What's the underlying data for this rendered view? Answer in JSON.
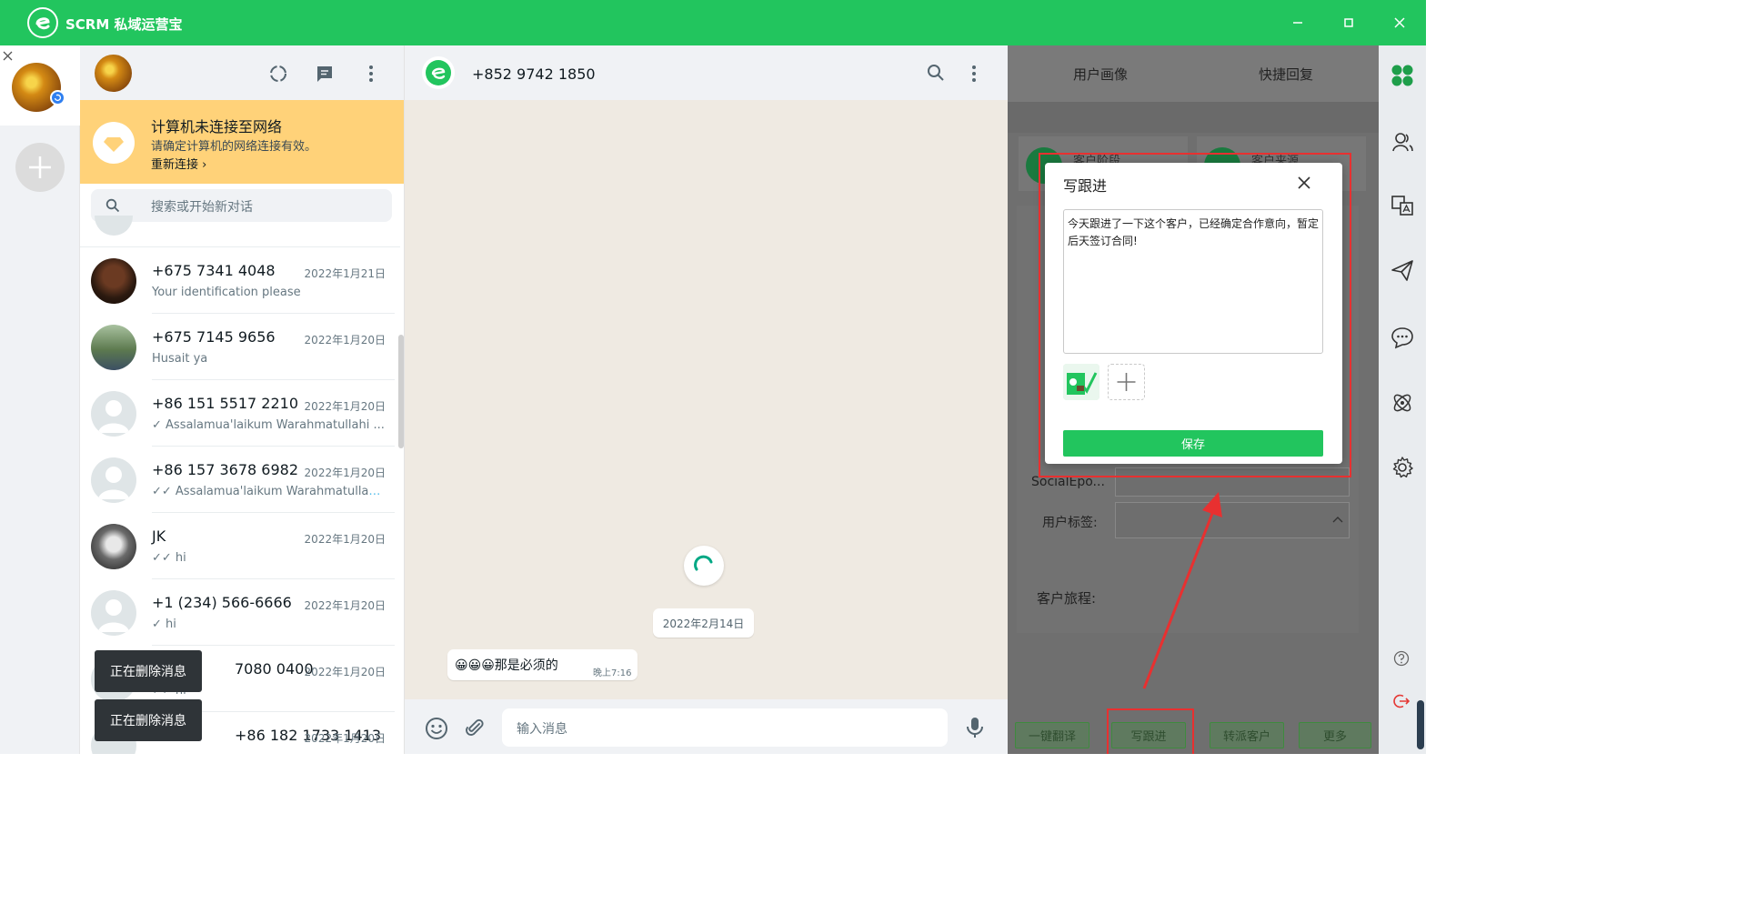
{
  "app": {
    "title": "SCRM 私域运营宝"
  },
  "chatlist": {
    "banner": {
      "title": "计算机未连接至网络",
      "subtitle": "请确定计算机的网络连接有效。",
      "link": "重新连接 ›"
    },
    "search_placeholder": "搜索或开始新对话",
    "chats": [
      {
        "name": "+675 7341 4048",
        "date": "2022年1月21日",
        "msg": "Your identification please"
      },
      {
        "name": "+675 7145 9656",
        "date": "2022年1月20日",
        "msg": "Husait ya"
      },
      {
        "name": "+86 151 5517 2210",
        "date": "2022年1月20日",
        "msg": "✓ Assalamua'laikum Warahmatullahi ..."
      },
      {
        "name": "+86 157 3678 6982",
        "date": "2022年1月20日",
        "msg": "✓✓ Assalamua'laikum Warahmatullahi ..."
      },
      {
        "name": "JK",
        "date": "2022年1月20日",
        "msg": "✓✓ hi"
      },
      {
        "name": "+1 (234) 566-6666",
        "date": "2022年1月20日",
        "msg": "✓ hi"
      },
      {
        "name": "7080 0400",
        "date": "2022年1月20日",
        "msg": "✓✓ hi"
      },
      {
        "name": "+86 182 1733 1413",
        "date": "2022年1月20日",
        "msg": ""
      }
    ],
    "toasts": [
      "正在删除消息",
      "正在删除消息"
    ]
  },
  "chat": {
    "contact": "+852 9742 1850",
    "date_chip": "2022年2月14日",
    "message": {
      "text": "😀😀😀那是必须的",
      "time": "晚上7:16"
    },
    "input_placeholder": "输入消息"
  },
  "right_panel": {
    "tabs": [
      "用户画像",
      "快捷回复"
    ],
    "partial_labels": [
      "客户阶段",
      "客户来源"
    ],
    "field_social": "SocialEpo...",
    "field_tags": "用户标签:",
    "journey": "客户旅程:",
    "bottom_buttons": [
      "一键翻译",
      "写跟进",
      "转派客户",
      "更多"
    ]
  },
  "modal": {
    "title": "写跟进",
    "text": "今天跟进了一下这个客户，已经确定合作意向，暂定后天签订合同!",
    "save": "保存"
  },
  "colors": {
    "brand": "#22c55e",
    "banner": "#ffd279",
    "annotation": "#e83030"
  }
}
